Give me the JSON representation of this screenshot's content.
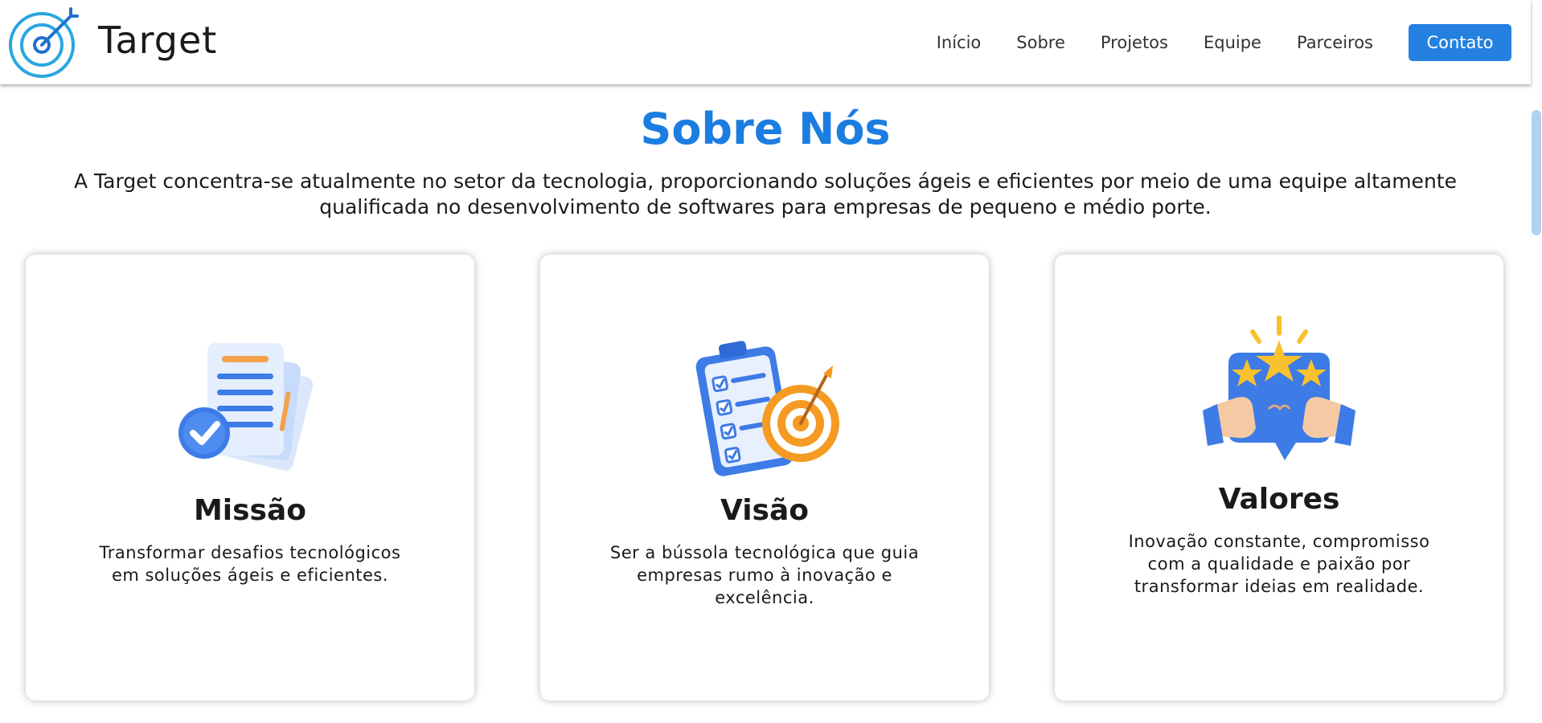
{
  "brand": {
    "name": "Target",
    "logo_icon": "target-logo-icon"
  },
  "nav": {
    "items": [
      "Início",
      "Sobre",
      "Projetos",
      "Equipe",
      "Parceiros"
    ],
    "contact": "Contato"
  },
  "about": {
    "title": "Sobre Nós",
    "description": "A Target concentra-se atualmente no setor da tecnologia, proporcionando soluções ágeis e eficientes por meio de uma equipe altamente qualificada no desenvolvimento de softwares para empresas de pequeno e médio porte."
  },
  "cards": [
    {
      "icon": "documents-check-icon",
      "title": "Missão",
      "text": "Transformar desafios tecnológicos em soluções ágeis e eficientes."
    },
    {
      "icon": "checklist-target-icon",
      "title": "Visão",
      "text": "Ser a bússola tecnológica que guia empresas rumo à inovação e excelência."
    },
    {
      "icon": "thumbs-up-stars-icon",
      "title": "Valores",
      "text": "Inovação constante, compromisso com a qualidade e paixão por transformar ideias em realidade."
    }
  ],
  "colors": {
    "accent": "#1b7de0",
    "button": "#2581e0",
    "icon_blue": "#3d7be6",
    "icon_orange": "#f59a22",
    "star_yellow": "#f9c12e"
  }
}
